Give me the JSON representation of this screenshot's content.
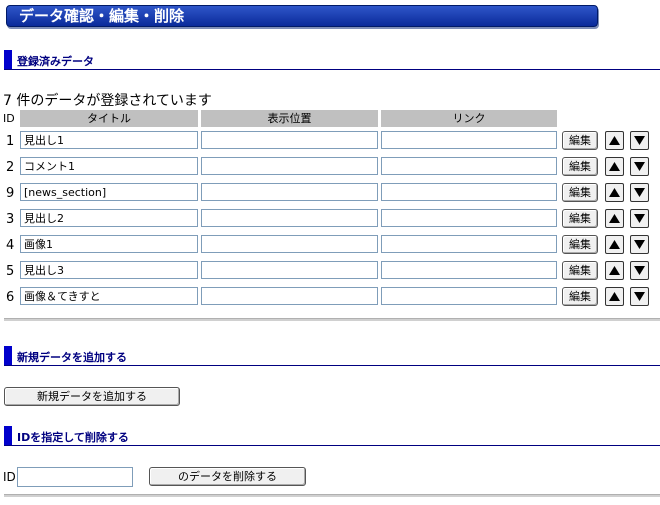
{
  "window": {
    "title": "データ確認・編集・削除"
  },
  "sections": {
    "registered": "登録済みデータ",
    "add": "新規データを追加する",
    "delete": "IDを指定して削除する"
  },
  "count_text": "7 件のデータが登録されています",
  "table": {
    "headers": {
      "id": "ID",
      "title": "タイトル",
      "position": "表示位置",
      "link": "リンク"
    },
    "edit_label": "編集",
    "rows": [
      {
        "id": "1",
        "title": "見出し1",
        "position": "",
        "link": ""
      },
      {
        "id": "2",
        "title": "コメント1",
        "position": "",
        "link": ""
      },
      {
        "id": "9",
        "title": "[news_section]",
        "position": "",
        "link": ""
      },
      {
        "id": "3",
        "title": "見出し2",
        "position": "",
        "link": ""
      },
      {
        "id": "4",
        "title": "画像1",
        "position": "",
        "link": ""
      },
      {
        "id": "5",
        "title": "見出し3",
        "position": "",
        "link": ""
      },
      {
        "id": "6",
        "title": "画像＆てきすと",
        "position": "",
        "link": ""
      }
    ]
  },
  "add_button_label": "新規データを追加する",
  "delete_form": {
    "id_label": "ID",
    "id_value": "",
    "button_label": "のデータを削除する"
  },
  "icons": {
    "up": "up-arrow-icon",
    "down": "down-arrow-icon"
  },
  "colors": {
    "title_bar": "#1a3fb5",
    "section_accent": "#0000cc",
    "section_text": "#000080",
    "header_bg": "#c0c0c0"
  }
}
